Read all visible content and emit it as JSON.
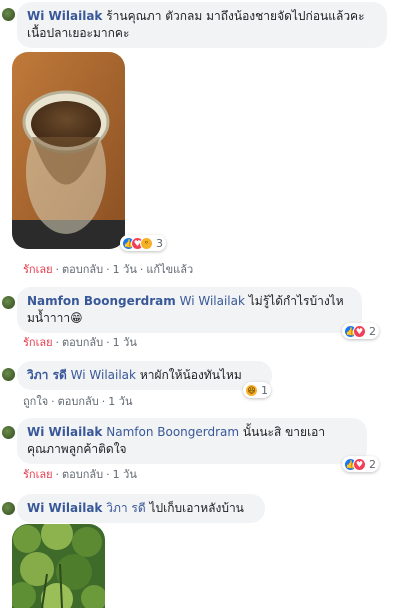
{
  "comments": [
    {
      "author": "Wi Wilailak",
      "text": "ร้านคุณภา ตัวกลม มาถึงน้องชายจัดไปก่อนแล้วคะ เนื้อปลาเยอะมากคะ",
      "reactions": {
        "icons": [
          "like-icon",
          "love-icon",
          "wow-icon"
        ],
        "count": "3"
      },
      "actions": {
        "like": "รักเลย",
        "reply": "ตอบกลับ",
        "time": "1 วัน",
        "edited": "แก้ไขแล้ว"
      }
    },
    {
      "author": "Namfon Boongerdram",
      "mention": "Wi Wilailak",
      "text": "ไม่รู้ได้กำไรบ้างไหมน้ำาาา😁",
      "reactions": {
        "icons": [
          "like-icon",
          "love-icon"
        ],
        "count": "2"
      },
      "actions": {
        "like": "รักเลย",
        "reply": "ตอบกลับ",
        "time": "1 วัน"
      }
    },
    {
      "author": "วิภา รดี",
      "mention": "Wi Wilailak",
      "text": "หาผักให้น้องทันไหม",
      "reactions": {
        "icons": [
          "haha-icon"
        ],
        "count": "1"
      },
      "actions": {
        "like": "ถูกใจ",
        "reply": "ตอบกลับ",
        "time": "1 วัน"
      }
    },
    {
      "author": "Wi Wilailak",
      "mention": "Namfon Boongerdram",
      "text": "นั้นนะสิ ขายเอาคุณภาพลูกค้าติดใจ",
      "reactions": {
        "icons": [
          "like-icon",
          "love-icon"
        ],
        "count": "2"
      },
      "actions": {
        "like": "รักเลย",
        "reply": "ตอบกลับ",
        "time": "1 วัน"
      }
    },
    {
      "author": "Wi Wilailak",
      "mention": "วิภา รดี",
      "text": "ไปเก็บเอาหลังบ้าน"
    }
  ]
}
